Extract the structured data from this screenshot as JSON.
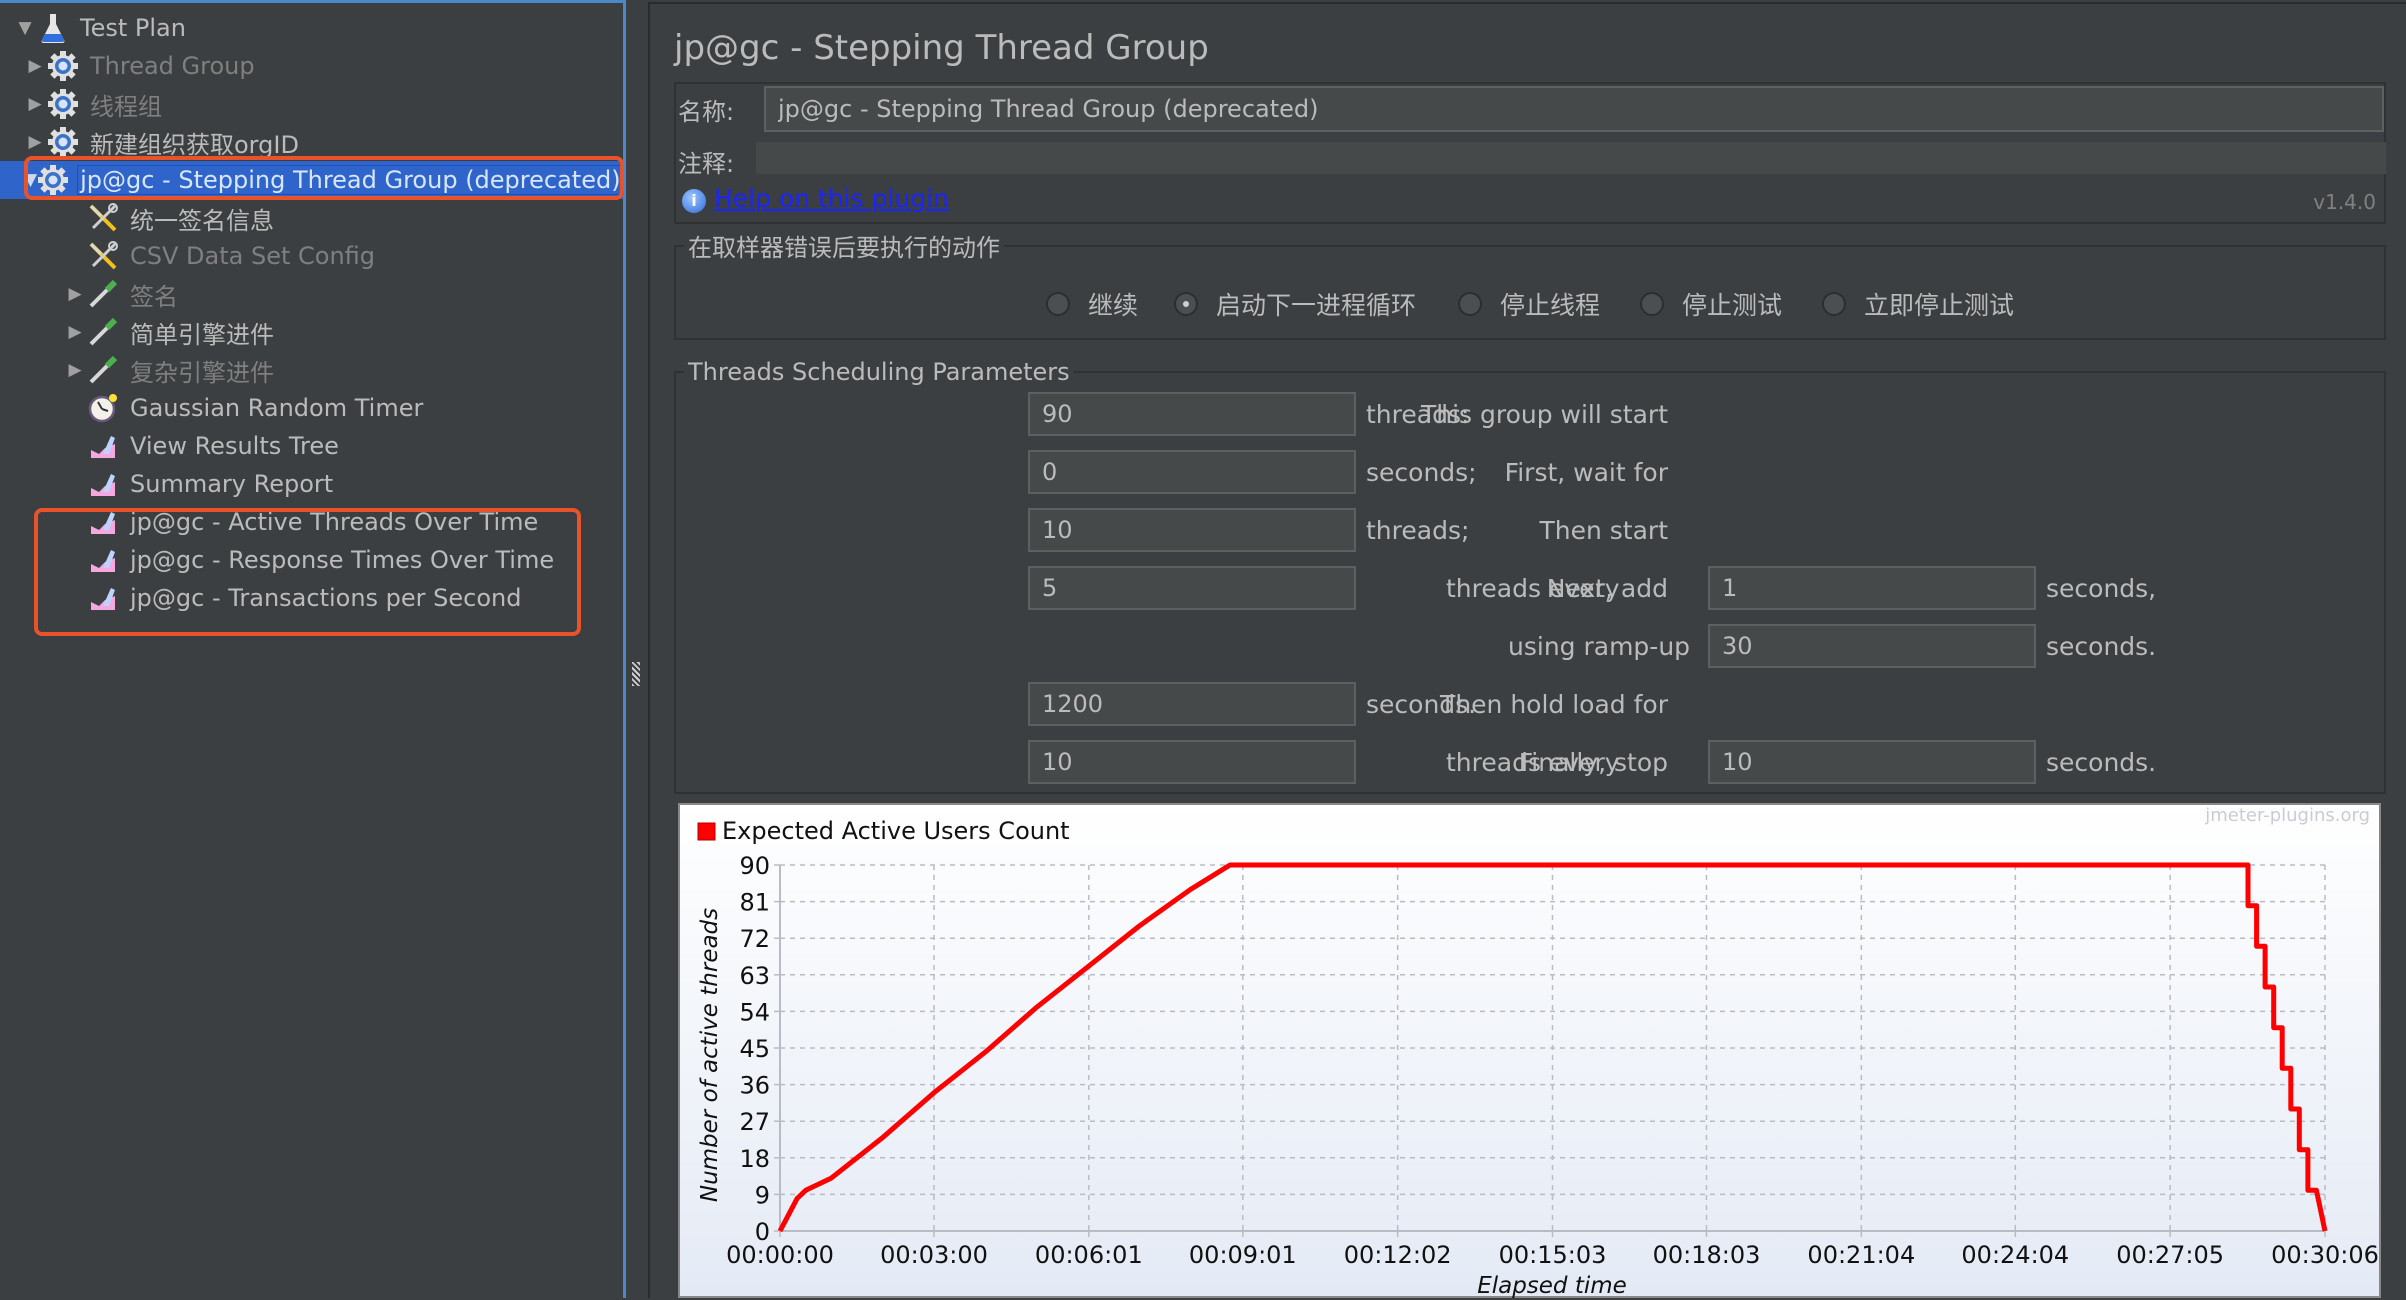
{
  "sidebar": {
    "tree": [
      {
        "label": "Test Plan",
        "icon": "test-plan-flask-icon",
        "expanded": true,
        "level": 0,
        "dim": false
      },
      {
        "label": "Thread Group",
        "icon": "thread-group-gear-icon",
        "expanded": false,
        "level": 1,
        "dim": true
      },
      {
        "label": "线程组",
        "icon": "thread-group-gear-icon",
        "expanded": false,
        "level": 1,
        "dim": true
      },
      {
        "label": "新建组织获取orgID",
        "icon": "thread-group-gear-icon",
        "expanded": false,
        "level": 1,
        "dim": false
      },
      {
        "label": "jp@gc - Stepping Thread Group (deprecated)",
        "icon": "thread-group-gear-icon",
        "expanded": true,
        "level": 1,
        "dim": false,
        "selected": true
      },
      {
        "label": "统一签名信息",
        "icon": "config-element-tools-icon",
        "level": 2,
        "dim": false
      },
      {
        "label": "CSV Data Set Config",
        "icon": "config-element-tools-icon",
        "level": 2,
        "dim": true
      },
      {
        "label": "签名",
        "icon": "sampler-pipette-icon",
        "expanded": false,
        "level": 2,
        "dim": true
      },
      {
        "label": "简单引擎进件",
        "icon": "sampler-pipette-icon",
        "expanded": false,
        "level": 2,
        "dim": false
      },
      {
        "label": "复杂引擎进件",
        "icon": "sampler-pipette-icon",
        "expanded": false,
        "level": 2,
        "dim": true
      },
      {
        "label": "Gaussian Random Timer",
        "icon": "timer-clock-icon",
        "level": 2,
        "dim": false
      },
      {
        "label": "View Results Tree",
        "icon": "listener-graph-icon",
        "level": 2,
        "dim": false
      },
      {
        "label": "Summary Report",
        "icon": "listener-graph-icon",
        "level": 2,
        "dim": false
      },
      {
        "label": "jp@gc - Active Threads Over Time",
        "icon": "listener-graph-icon",
        "level": 2,
        "dim": false
      },
      {
        "label": "jp@gc - Response Times Over Time",
        "icon": "listener-graph-icon",
        "level": 2,
        "dim": false
      },
      {
        "label": "jp@gc - Transactions per Second",
        "icon": "listener-graph-icon",
        "level": 2,
        "dim": false
      }
    ]
  },
  "main": {
    "title": "jp@gc - Stepping Thread Group",
    "name_label": "名称:",
    "name_value": "jp@gc - Stepping Thread Group (deprecated)",
    "comment_label": "注释:",
    "comment_value": "",
    "help_link": "Help on this plugin",
    "version": "v1.4.0",
    "error_action": {
      "legend": "在取样器错误后要执行的动作",
      "options": [
        {
          "label": "继续",
          "selected": false
        },
        {
          "label": "启动下一进程循环",
          "selected": true
        },
        {
          "label": "停止线程",
          "selected": false
        },
        {
          "label": "停止测试",
          "selected": false
        },
        {
          "label": "立即停止测试",
          "selected": false
        }
      ]
    },
    "scheduling": {
      "legend": "Threads Scheduling Parameters",
      "start_threads_label": "This group will start",
      "start_threads": "90",
      "start_threads_unit": "threads:",
      "initial_delay_label": "First, wait for",
      "initial_delay": "0",
      "initial_delay_unit": "seconds;",
      "start_users_label": "Then start",
      "start_users": "10",
      "start_users_unit": "threads;",
      "add_users_label": "Next, add",
      "add_users": "5",
      "add_every_label": "threads every",
      "add_every": "1",
      "add_every_unit": "seconds,",
      "rampup_label": "using ramp-up",
      "rampup": "30",
      "rampup_unit": "seconds.",
      "hold_label": "Then hold load for",
      "hold": "1200",
      "hold_unit": "seconds.",
      "stop_label": "Finally, stop",
      "stop_users": "10",
      "stop_every_label": "threads every",
      "stop_every": "10",
      "stop_every_unit": "seconds."
    }
  },
  "chart_data": {
    "type": "line",
    "title": "",
    "legend": [
      {
        "name": "Expected Active Users Count",
        "color": "#ff0000"
      }
    ],
    "legend_position": "top-left",
    "watermark": "jmeter-plugins.org",
    "xlabel": "Elapsed time",
    "ylabel": "Number of active threads",
    "xlim_seconds": [
      0,
      1806
    ],
    "ylim": [
      0,
      90
    ],
    "yticks": [
      0,
      9,
      18,
      27,
      36,
      45,
      54,
      63,
      72,
      81,
      90
    ],
    "xticks": [
      {
        "seconds": 0,
        "label": "00:00:00"
      },
      {
        "seconds": 180,
        "label": "00:03:00"
      },
      {
        "seconds": 361,
        "label": "00:06:01"
      },
      {
        "seconds": 541,
        "label": "00:09:01"
      },
      {
        "seconds": 722,
        "label": "00:12:02"
      },
      {
        "seconds": 903,
        "label": "00:15:03"
      },
      {
        "seconds": 1083,
        "label": "00:18:03"
      },
      {
        "seconds": 1264,
        "label": "00:21:04"
      },
      {
        "seconds": 1444,
        "label": "00:24:04"
      },
      {
        "seconds": 1625,
        "label": "00:27:05"
      },
      {
        "seconds": 1806,
        "label": "00:30:06"
      }
    ],
    "grid": true,
    "series": [
      {
        "name": "Expected Active Users Count",
        "color": "#ff0000",
        "points": [
          [
            0,
            0
          ],
          [
            10,
            4
          ],
          [
            20,
            8
          ],
          [
            30,
            10
          ],
          [
            60,
            13
          ],
          [
            120,
            23
          ],
          [
            180,
            34
          ],
          [
            240,
            44
          ],
          [
            300,
            55
          ],
          [
            360,
            65
          ],
          [
            420,
            75
          ],
          [
            480,
            84
          ],
          [
            526,
            90
          ],
          [
            1716,
            90
          ],
          [
            1716,
            80
          ],
          [
            1726,
            80
          ],
          [
            1726,
            70
          ],
          [
            1736,
            70
          ],
          [
            1736,
            60
          ],
          [
            1746,
            60
          ],
          [
            1746,
            50
          ],
          [
            1756,
            50
          ],
          [
            1756,
            40
          ],
          [
            1766,
            40
          ],
          [
            1766,
            30
          ],
          [
            1776,
            30
          ],
          [
            1776,
            20
          ],
          [
            1786,
            20
          ],
          [
            1786,
            10
          ],
          [
            1796,
            10
          ],
          [
            1806,
            0
          ]
        ]
      }
    ]
  }
}
